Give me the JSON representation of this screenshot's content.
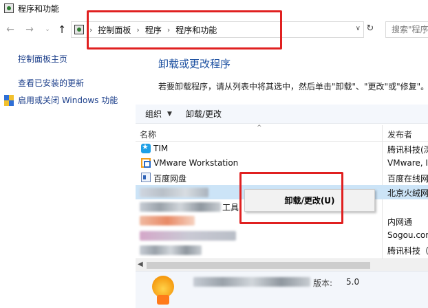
{
  "window": {
    "title": "程序和功能"
  },
  "address": {
    "breadcrumbs": [
      "控制面板",
      "程序",
      "程序和功能"
    ],
    "search_placeholder": "搜索\"程序和功能\""
  },
  "left_pane": {
    "home": "控制面板主页",
    "view_updates": "查看已安装的更新",
    "features": "启用或关闭 Windows 功能"
  },
  "main": {
    "title": "卸载或更改程序",
    "description": "若要卸载程序，请从列表中将其选中，然后单击\"卸载\"、\"更改\"或\"修复\"。"
  },
  "toolbar": {
    "organize": "组织",
    "uninstall_change": "卸载/更改"
  },
  "columns": {
    "name": "名称",
    "publisher": "发布者"
  },
  "programs": [
    {
      "name": "TIM",
      "publisher": "腾讯科技(深圳)有限公司",
      "icon": "tim-icon"
    },
    {
      "name": "VMware Workstation",
      "publisher": "VMware, Inc.",
      "icon": "vmware-icon"
    },
    {
      "name": "百度网盘",
      "publisher": "百度在线网络技术",
      "icon": "baidu-netdisk-icon"
    },
    {
      "name": "",
      "publisher": "北京火绒网络科技",
      "icon": "blurred-icon",
      "selected": true
    },
    {
      "name": "工具",
      "publisher": "",
      "icon": "blurred-icon"
    },
    {
      "name": "",
      "publisher": "内网通",
      "icon": "blurred-icon"
    },
    {
      "name": "",
      "publisher": "Sogou.com",
      "icon": "blurred-icon"
    },
    {
      "name": "",
      "publisher": "腾讯科技（深圳）",
      "icon": "blurred-icon"
    }
  ],
  "context_menu": {
    "item": "卸载/更改(U)"
  },
  "details": {
    "version_label": "版本:",
    "version_value": "5.0"
  },
  "colors": {
    "accent_link": "#1b3e8a",
    "title_blue": "#1b4fa0",
    "selection": "#cce4f7",
    "annotation_red": "#e02020"
  }
}
